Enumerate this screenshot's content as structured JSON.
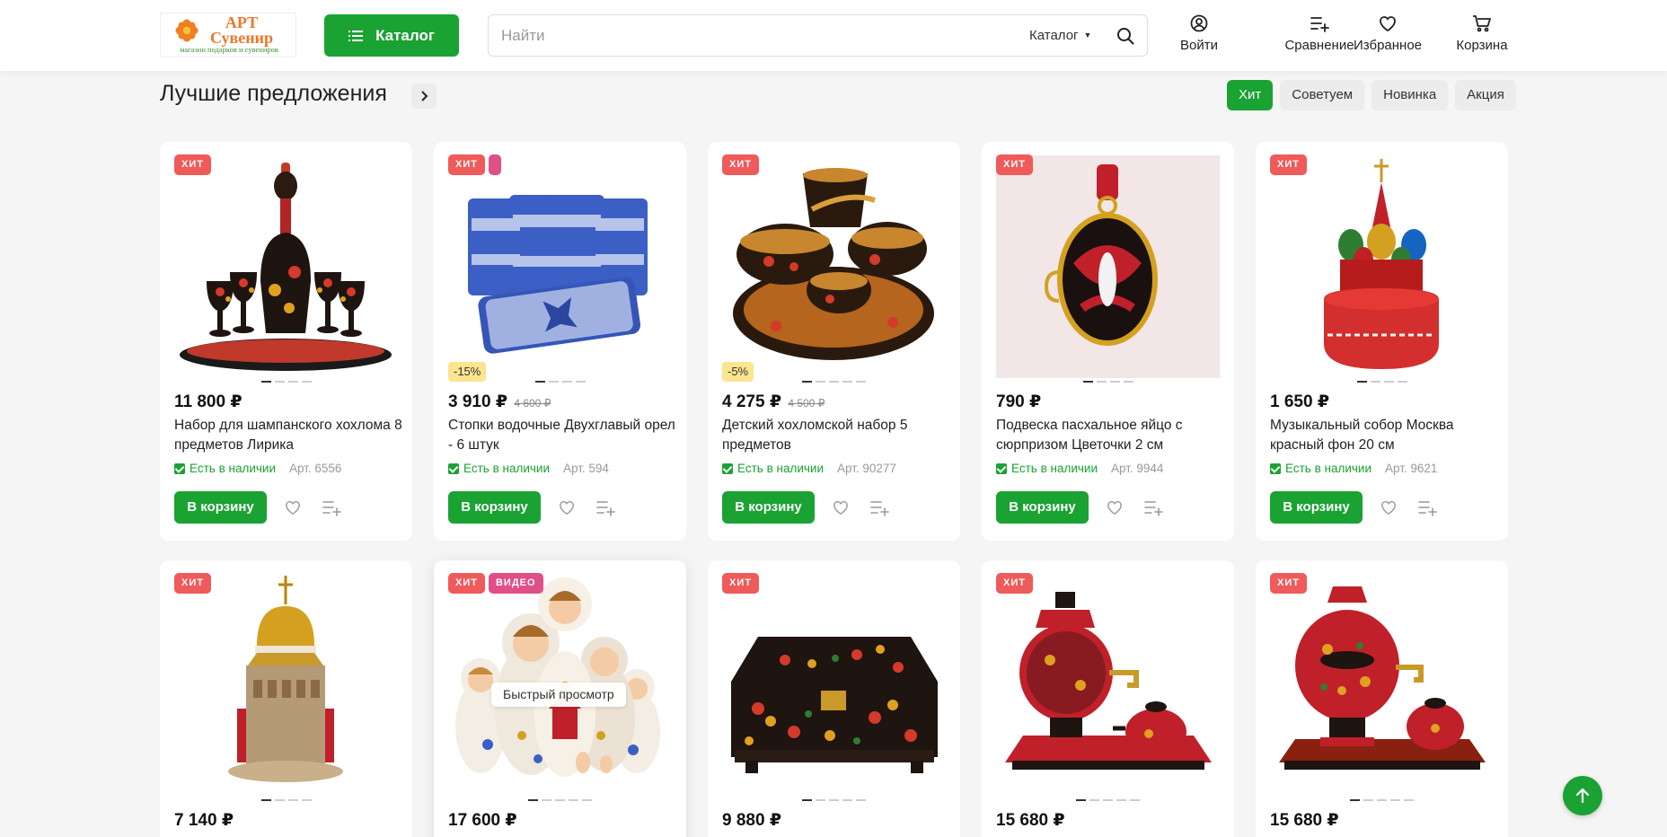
{
  "header": {
    "logo_title_1": "АРТ",
    "logo_title_2": "Сувенир",
    "logo_subtitle": "магазин подарков и сувениров",
    "catalog_button": "Каталог",
    "search_placeholder": "Найти",
    "search_scope": "Каталог",
    "actions": {
      "login": "Войти",
      "compare": "Сравнение",
      "favorites": "Избранное",
      "cart": "Корзина"
    }
  },
  "section": {
    "title": "Лучшие предложения",
    "filters": [
      "Хит",
      "Советуем",
      "Новинка",
      "Акция"
    ],
    "active_filter": "Хит"
  },
  "products": [
    {
      "badges": [
        "ХИТ"
      ],
      "price": "11 800 ₽",
      "title": "Набор для шампанского хохлома 8 предметов Лирика",
      "stock": "Есть в наличии",
      "article": "Арт. 6556",
      "cart": "В корзину"
    },
    {
      "badges": [
        "ХИТ"
      ],
      "discount": "-15%",
      "price": "3 910 ₽",
      "old_price": "4 600 ₽",
      "title": "Стопки водочные Двухглавый орел - 6 штук",
      "stock": "Есть в наличии",
      "article": "Арт. 594",
      "cart": "В корзину"
    },
    {
      "badges": [
        "ХИТ"
      ],
      "discount": "-5%",
      "price": "4 275 ₽",
      "old_price": "4 500 ₽",
      "title": "Детский хохломской набор 5 предметов",
      "stock": "Есть в наличии",
      "article": "Арт. 90277",
      "cart": "В корзину"
    },
    {
      "badges": [
        "ХИТ"
      ],
      "price": "790 ₽",
      "title": "Подвеска пасхальное яйцо с сюрпризом Цветочки 2 см",
      "stock": "Есть в наличии",
      "article": "Арт. 9944",
      "cart": "В корзину"
    },
    {
      "badges": [
        "ХИТ"
      ],
      "price": "1 650 ₽",
      "title": "Музыкальный собор Москва красный фон 20 см",
      "stock": "Есть в наличии",
      "article": "Арт. 9621",
      "cart": "В корзину"
    },
    {
      "badges": [
        "ХИТ"
      ],
      "price": "7 140 ₽"
    },
    {
      "badges": [
        "ХИТ",
        "ВИДЕО"
      ],
      "price": "17 600 ₽",
      "quick_view": "Быстрый просмотр"
    },
    {
      "badges": [
        "ХИТ"
      ],
      "price": "9 880 ₽"
    },
    {
      "badges": [
        "ХИТ"
      ],
      "price": "15 680 ₽"
    },
    {
      "badges": [
        "ХИТ"
      ],
      "price": "15 680 ₽"
    }
  ],
  "colors": {
    "accent_green": "#1aa233",
    "hit_badge": "#ef5a5a",
    "video_badge": "#e04f86",
    "discount_bg": "#fbe58f"
  }
}
